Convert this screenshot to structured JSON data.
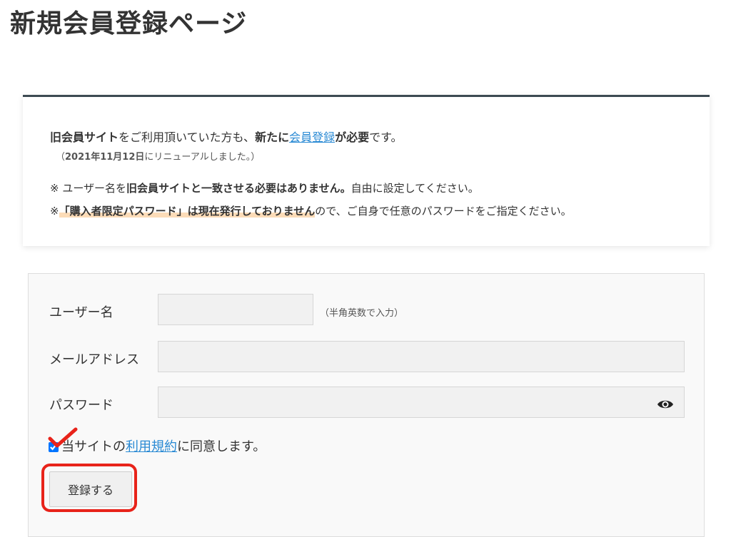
{
  "page": {
    "title": "新規会員登録ページ"
  },
  "notice": {
    "line1": {
      "old_site": "旧会員サイト",
      "text_a": "をご利用頂いていた方も、",
      "newly": "新たに",
      "link": "会員登録",
      "required": "が必要",
      "text_b": "です。"
    },
    "line2": {
      "open": "（",
      "date": "2021年11月12日",
      "rest": "にリニューアルしました。）"
    },
    "line3": {
      "prefix": "※ ユーザー名を",
      "bold": "旧会員サイトと一致させる必要はありません。",
      "rest": "自由に設定してください。"
    },
    "line4": {
      "prefix": "※",
      "bold": "「購入者限定パスワード」は現在発行しておりません",
      "rest": "ので、ご自身で任意のパスワードをご指定ください。"
    }
  },
  "form": {
    "username": {
      "label": "ユーザー名",
      "value": "",
      "hint": "（半角英数で入力）"
    },
    "email": {
      "label": "メールアドレス",
      "value": ""
    },
    "password": {
      "label": "パスワード",
      "value": ""
    },
    "agree": {
      "prefix": "当サイトの",
      "link": "利用規約",
      "suffix": "に同意します。",
      "checked": true
    },
    "submit_label": "登録する"
  },
  "colors": {
    "accent_link": "#2a8ad4",
    "annotation": "#e8231a",
    "highlight": "#fcdcb8",
    "notice_border": "#3d4a52"
  }
}
